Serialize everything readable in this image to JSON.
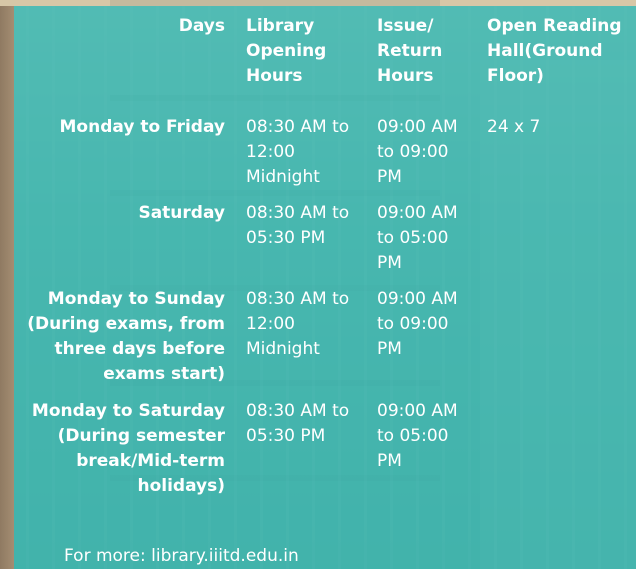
{
  "table": {
    "headers": [
      "Days",
      "Library Opening Hours",
      "Issue/ Return Hours",
      "Open Reading Hall(Ground Floor)"
    ],
    "rows": [
      {
        "days": "Monday to Friday",
        "opening": "08:30 AM to 12:00 Midnight",
        "issue": "09:00 AM to 09:00 PM",
        "reading": "24 x 7"
      },
      {
        "days": "Saturday",
        "opening": "08:30 AM to 05:30 PM",
        "issue": "09:00 AM to 05:00 PM",
        "reading": ""
      },
      {
        "days": "Monday to Sunday (During exams, from three days before exams start)",
        "opening": "08:30 AM to 12:00 Midnight",
        "issue": "09:00 AM to 09:00 PM",
        "reading": ""
      },
      {
        "days": "Monday to Saturday (During semester break/Mid-term holidays)",
        "opening": "08:30 AM to 05:30 PM",
        "issue": "09:00 AM to 05:00 PM",
        "reading": ""
      }
    ]
  },
  "footer": {
    "text": "For more: library.iiitd.edu.in"
  }
}
